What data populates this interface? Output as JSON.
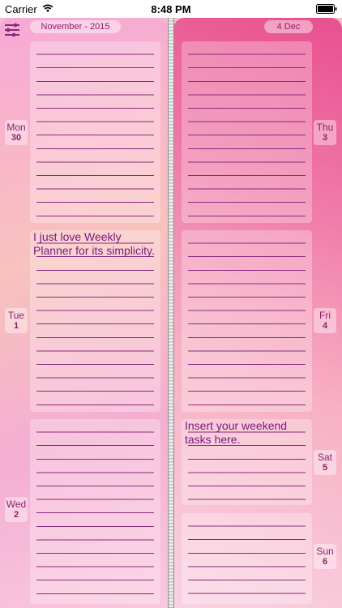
{
  "status_bar": {
    "carrier": "Carrier",
    "time": "8:48 PM"
  },
  "header": {
    "month_label": "November - 2015",
    "date_label": "4 Dec"
  },
  "icons": {
    "settings": "sliders-icon",
    "wifi": "wifi-icon",
    "battery": "battery-icon"
  },
  "colors": {
    "accent_text": "#8c1f6e",
    "ruled_line": "#8a2a7c"
  },
  "days": {
    "mon": {
      "name": "Mon",
      "number": "30",
      "note": ""
    },
    "tue": {
      "name": "Tue",
      "number": "1",
      "note": "I just love Weekly Planner for its simplicity."
    },
    "wed": {
      "name": "Wed",
      "number": "2",
      "note": ""
    },
    "thu": {
      "name": "Thu",
      "number": "3",
      "note": ""
    },
    "fri": {
      "name": "Fri",
      "number": "4",
      "note": ""
    },
    "sat": {
      "name": "Sat",
      "number": "5",
      "note": "Insert your weekend tasks here."
    },
    "sun": {
      "name": "Sun",
      "number": "6",
      "note": ""
    }
  }
}
